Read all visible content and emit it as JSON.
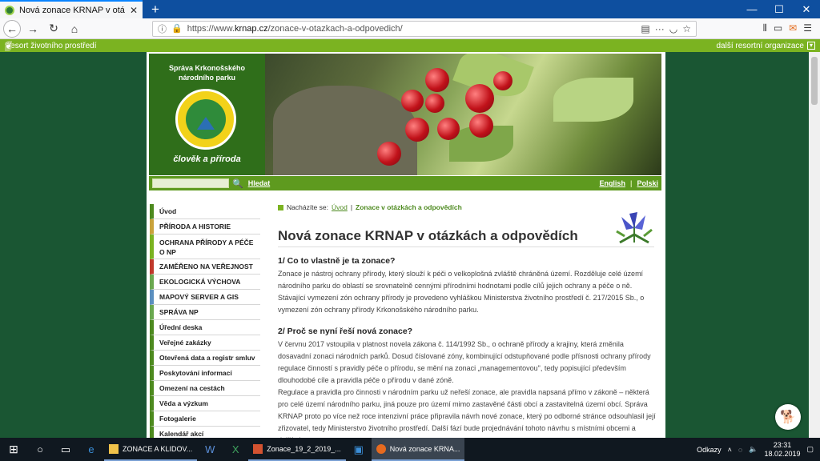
{
  "browser": {
    "tab_title": "Nová zonace KRNAP v otázkách",
    "url_prefix": "https://www.",
    "url_domain": "krnap.cz",
    "url_path": "/zonace-v-otazkach-a-odpovedich/"
  },
  "resort_bar": {
    "left": "Resort životního prostředí",
    "right": "další resortní organizace"
  },
  "banner": {
    "org_line1": "Správa Krkonošského",
    "org_line2": "národního parku",
    "motto": "člověk a příroda"
  },
  "search": {
    "button": "Hledat",
    "lang_en": "English",
    "lang_pl": "Polski"
  },
  "menu": [
    "Úvod",
    "PŘÍRODA A HISTORIE",
    "OCHRANA PŘÍRODY A PÉČE O NP",
    "ZAMĚŘENO NA VEŘEJNOST",
    "EKOLOGICKÁ VÝCHOVA",
    "MAPOVÝ SERVER A GIS",
    "SPRÁVA NP",
    "Úřední deska",
    "Veřejné zakázky",
    "Otevřená data a registr smluv",
    "Poskytování informací",
    "Omezení na cestách",
    "Věda a výzkum",
    "Fotogalerie",
    "Kalendář akcí"
  ],
  "menu_colors": [
    "#4d8a1f",
    "#c9a23b",
    "#7bb321",
    "#c0392b",
    "#6aa84f",
    "#5b8fbf",
    "#6aa84f",
    "#4d8a1f",
    "#4d8a1f",
    "#4d8a1f",
    "#4d8a1f",
    "#4d8a1f",
    "#4d8a1f",
    "#4d8a1f",
    "#4d8a1f"
  ],
  "breadcrumb": {
    "label": "Nacházíte se:",
    "home": "Úvod",
    "current": "Zonace v otázkách a odpovědích"
  },
  "article": {
    "title": "Nová zonace KRNAP v otázkách a odpovědích",
    "q1": "1/ Co to vlastně je ta zonace?",
    "a1": "Zonace je nástroj ochrany přírody, který slouží k péči o velkoplošná zvláště chráněná území. Rozděluje celé území národního parku do oblastí se srovnatelně cennými přírodními hodnotami podle cílů jejich ochrany a péče o ně. Stávající vymezení zón ochrany přírody je provedeno vyhláškou Ministerstva životního prostředí č. 217/2015 Sb., o vymezení zón ochrany přírody Krkonošského národního parku.",
    "q2": "2/ Proč se nyní řeší nová zonace?",
    "a2a": "V červnu 2017 vstoupila v platnost novela zákona č. 114/1992 Sb., o ochraně přírody a krajiny, která změnila dosavadní zonaci národních parků. Dosud číslované zóny, kombinující odstupňované podle přísnosti ochrany přírody regulace činností s pravidly péče o přírodu, se mění na zonaci „managementovou\", tedy popisující především dlouhodobé cíle a pravidla péče o přírodu v dané zóně.",
    "a2b": "Regulace a pravidla pro činnosti v národním parku už neřeší zonace, ale pravidla napsaná přímo v zákoně – některá pro celé území národního parku, jiná pouze pro území mimo zastavěné části obcí a zastavitelná území obcí. Správa KRNAP proto po více než roce intenzivní práce připravila návrh nové zonace, který po odborné stránce odsouhlasil její zřizovatel, tedy Ministerstvo životního prostředí. Další fází bude projednávání tohoto návrhu s místními obcemi a dalšími partnery."
  },
  "taskbar": {
    "app1": "ZONACE A KLIDOV...",
    "app2": "Zonace_19_2_2019_...",
    "app3": "Nová zonace KRNA...",
    "links": "Odkazy",
    "time": "23:31",
    "date": "18.02.2019"
  }
}
